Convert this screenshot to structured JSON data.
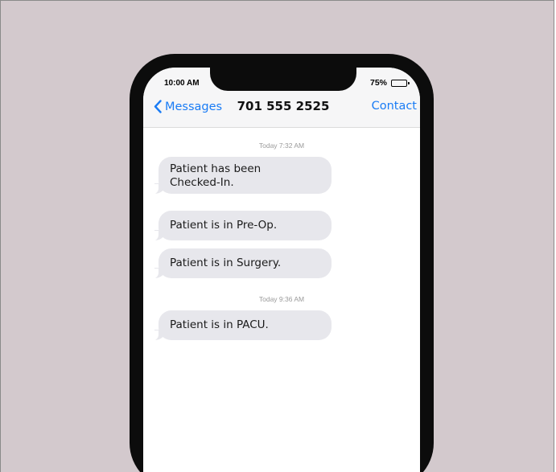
{
  "status_bar": {
    "time": "10:00 AM",
    "battery": "75%",
    "battery_level": 0.75
  },
  "nav": {
    "back_label": "Messages",
    "title": "701 555 2525",
    "action_label": "Contact",
    "accent_color": "#1a7cf5"
  },
  "messages": [
    {
      "timestamp": "Today 7:32 AM"
    },
    {
      "text": "Patient has been\nChecked-In."
    },
    {
      "text": "Patient is in Pre-Op."
    },
    {
      "text": "Patient is in Surgery."
    },
    {
      "timestamp": "Today 9:36 AM"
    },
    {
      "text": "Patient is in PACU."
    }
  ],
  "colors": {
    "background": "#d3c9cd",
    "bubble": "#e7e7ec",
    "link": "#1a7cf5"
  }
}
